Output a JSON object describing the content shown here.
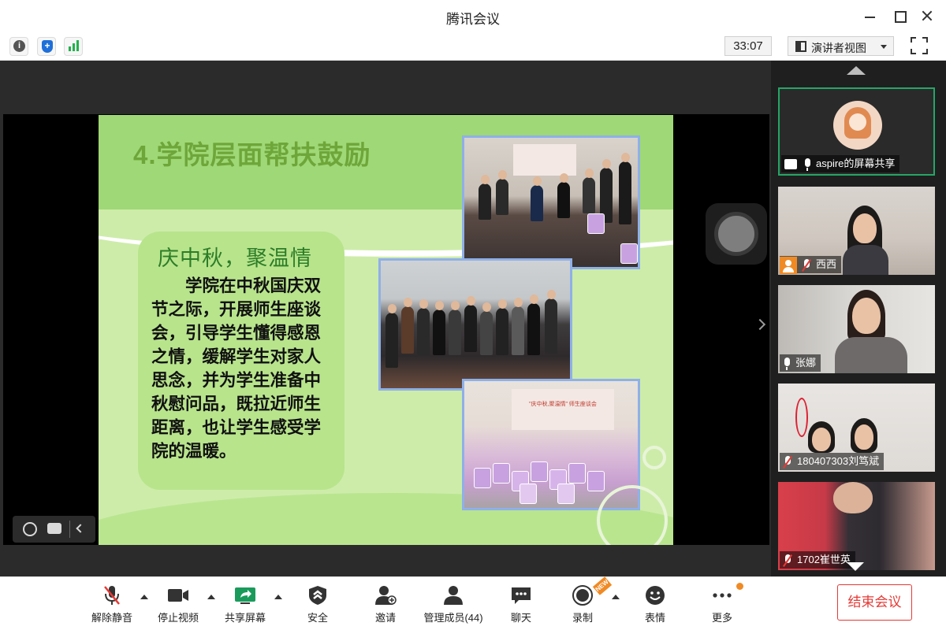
{
  "window": {
    "title": "腾讯会议"
  },
  "infobar": {
    "timer": "33:07",
    "view_mode": "演讲者视图"
  },
  "slide": {
    "title": "4.学院层面帮扶鼓励",
    "box_heading": "庆中秋，聚温情",
    "box_body": "学院在中秋国庆双节之际，开展师生座谈会，引导学生懂得感恩之情，缓解学生对家人思念，并为学生准备中秋慰问品，既拉近师生距离，也让学生感受学院的温暖。",
    "banner_text": "\"庆中秋,聚温情\" 师生座谈会"
  },
  "participants": [
    {
      "name": "aspire的屏幕共享",
      "mic": "on",
      "sharing": true
    },
    {
      "name": "西西",
      "mic": "muted",
      "host": true
    },
    {
      "name": "张娜",
      "mic": "on"
    },
    {
      "name": "180407303刘笃斌",
      "mic": "muted"
    },
    {
      "name": "1702崔世英",
      "mic": "muted"
    }
  ],
  "toolbar": {
    "unmute": "解除静音",
    "stop_video": "停止视频",
    "share_screen": "共享屏幕",
    "security": "安全",
    "invite": "邀请",
    "manage_members": "管理成员(44)",
    "chat": "聊天",
    "record": "录制",
    "reactions": "表情",
    "more": "更多",
    "end_meeting": "结束会议",
    "new_badge": "NEW"
  },
  "colors": {
    "accent_green": "#25a567",
    "end_red": "#e53935",
    "slide_green": "#9fd876",
    "badge_orange": "#f08a24"
  }
}
